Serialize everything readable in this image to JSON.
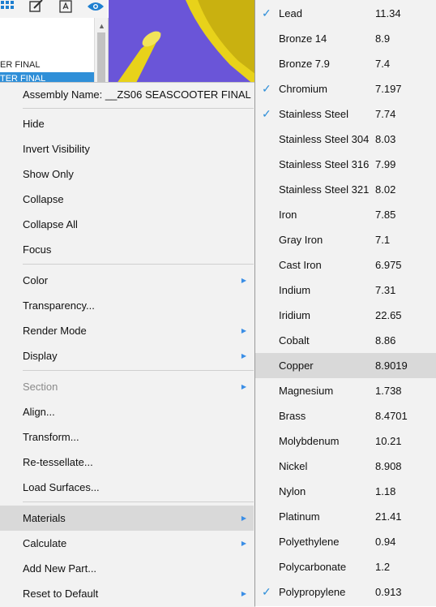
{
  "background": {
    "tree_rows": [
      "ER FINAL",
      "TER FINAL"
    ]
  },
  "context_menu": {
    "assembly_label": "Assembly Name: __ZS06 SEASCOOTER FINAL",
    "items": [
      {
        "label": "Hide",
        "has_submenu": false
      },
      {
        "label": "Invert Visibility",
        "has_submenu": false
      },
      {
        "label": "Show Only",
        "has_submenu": false
      },
      {
        "label": "Collapse",
        "has_submenu": false
      },
      {
        "label": "Collapse All",
        "has_submenu": false
      },
      {
        "label": "Focus",
        "has_submenu": false
      },
      {
        "label": "Color",
        "has_submenu": true
      },
      {
        "label": "Transparency...",
        "has_submenu": false
      },
      {
        "label": "Render Mode",
        "has_submenu": true
      },
      {
        "label": "Display",
        "has_submenu": true
      },
      {
        "label": "Section",
        "has_submenu": true,
        "disabled": true
      },
      {
        "label": "Align...",
        "has_submenu": false
      },
      {
        "label": "Transform...",
        "has_submenu": false
      },
      {
        "label": "Re-tessellate...",
        "has_submenu": false
      },
      {
        "label": "Load Surfaces...",
        "has_submenu": false
      },
      {
        "label": "Materials",
        "has_submenu": true,
        "highlighted": true
      },
      {
        "label": "Calculate",
        "has_submenu": true
      },
      {
        "label": "Add New Part...",
        "has_submenu": false
      },
      {
        "label": "Reset to Default",
        "has_submenu": true
      }
    ]
  },
  "materials_menu": {
    "items": [
      {
        "name": "Lead",
        "density": "11.34",
        "checked": true
      },
      {
        "name": "Bronze 14",
        "density": "8.9"
      },
      {
        "name": "Bronze 7.9",
        "density": "7.4"
      },
      {
        "name": "Chromium",
        "density": "7.197",
        "checked": true
      },
      {
        "name": "Stainless Steel",
        "density": "7.74",
        "checked": true
      },
      {
        "name": "Stainless Steel 304",
        "density": "8.03"
      },
      {
        "name": "Stainless Steel 316",
        "density": "7.99"
      },
      {
        "name": "Stainless Steel 321",
        "density": "8.02"
      },
      {
        "name": "Iron",
        "density": "7.85"
      },
      {
        "name": "Gray Iron",
        "density": "7.1"
      },
      {
        "name": "Cast Iron",
        "density": "6.975"
      },
      {
        "name": "Indium",
        "density": "7.31"
      },
      {
        "name": "Iridium",
        "density": "22.65"
      },
      {
        "name": "Cobalt",
        "density": "8.86"
      },
      {
        "name": "Copper",
        "density": "8.9019",
        "highlighted": true
      },
      {
        "name": "Magnesium",
        "density": "1.738"
      },
      {
        "name": "Brass",
        "density": "8.4701"
      },
      {
        "name": "Molybdenum",
        "density": "10.21"
      },
      {
        "name": "Nickel",
        "density": "8.908"
      },
      {
        "name": "Nylon",
        "density": "1.18"
      },
      {
        "name": "Platinum",
        "density": "21.41"
      },
      {
        "name": "Polyethylene",
        "density": "0.94"
      },
      {
        "name": "Polycarbonate",
        "density": "1.2"
      },
      {
        "name": "Polypropylene",
        "density": "0.913",
        "checked": true
      }
    ]
  },
  "colors": {
    "accent": "#2f8fd8",
    "highlight": "#d9d9d9",
    "viewport": "#6a55d8",
    "model": "#e8d21a"
  }
}
